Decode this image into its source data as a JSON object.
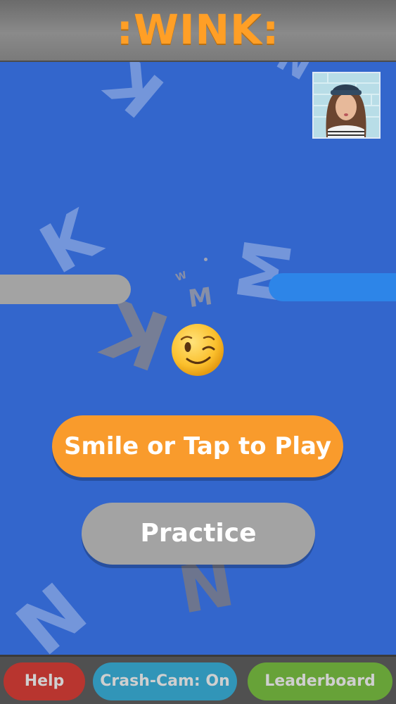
{
  "header": {
    "title": ":WINK:"
  },
  "game": {
    "emoji": "winking-face",
    "background_letters": [
      "K",
      "K",
      "K",
      "M",
      "M",
      "W",
      "N",
      "N",
      "N"
    ]
  },
  "buttons": {
    "play_label": "Smile or Tap to Play",
    "practice_label": "Practice"
  },
  "footer": {
    "help_label": "Help",
    "crash_cam_label": "Crash-Cam: On",
    "leaderboard_label": "Leaderboard"
  },
  "colors": {
    "background": "#3366cc",
    "title_orange": "#ff9f26",
    "play_button": "#f99b2c",
    "practice_button": "#a3a3a3",
    "help_button": "#b8352f",
    "crash_cam_button": "#3195b8",
    "leaderboard_button": "#67a238",
    "left_bar": "#a3a3a3",
    "right_bar": "#2d85e8"
  }
}
